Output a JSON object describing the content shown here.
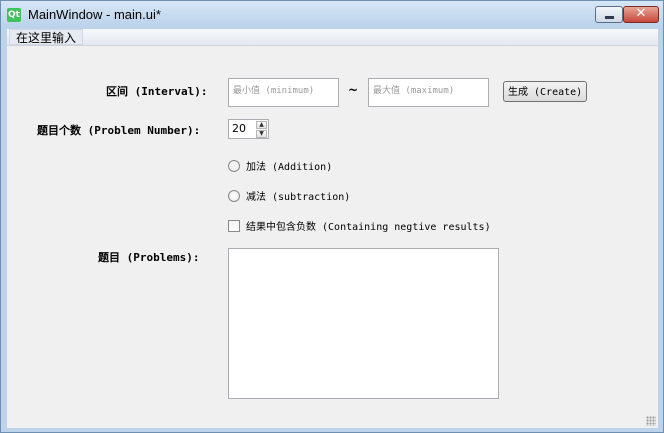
{
  "window": {
    "title": "MainWindow - main.ui*",
    "app_icon_glyph": "Qt",
    "minimize_icon": "minimize-icon",
    "close_icon": "close-icon",
    "close_glyph": "✕"
  },
  "menubar": {
    "items": [
      {
        "label": "在这里输入"
      }
    ]
  },
  "form": {
    "interval_label": "区间 (Interval):",
    "min_placeholder": "最小值 (minimum)",
    "tilde": "~",
    "max_placeholder": "最大值 (maximum)",
    "create_button": "生成 (Create)",
    "problem_number_label": "题目个数 (Problem Number):",
    "problem_number_value": "20",
    "addition_label": "加法 (Addition)",
    "subtraction_label": "减法 (subtraction)",
    "negative_label": "结果中包含负数 (Containing negtive results)",
    "problems_label": "题目 (Problems):",
    "problems_text": ""
  },
  "colors": {
    "titlebar": "#bcd3ea",
    "client_background": "#f0f0f0",
    "close_button": "#c7473a"
  }
}
